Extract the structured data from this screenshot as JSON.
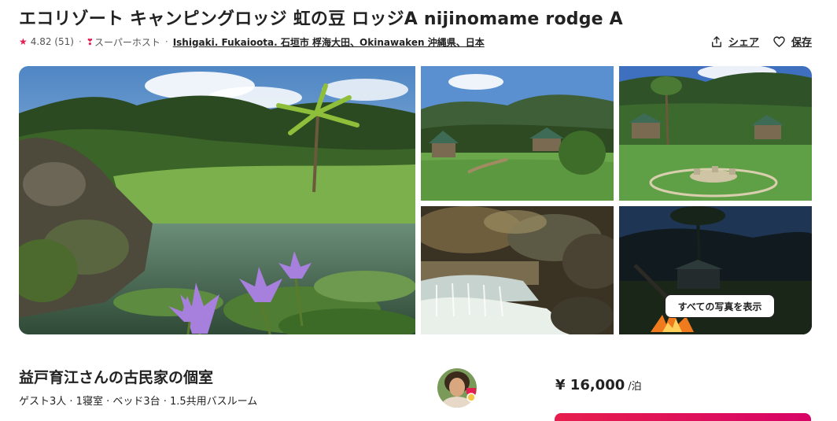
{
  "listing": {
    "title": "エコリゾート キャンピングロッジ 虹の豆 ロッジA nijinomame rodge A",
    "rating": "4.82 (51)",
    "separator": "·",
    "superhost": "スーパーホスト",
    "location": "Ishigaki. Fukaioota. 石垣市 桴海大田、Okinawaken 沖縄県、日本"
  },
  "actions": {
    "share_label": "シェア",
    "save_label": "保存"
  },
  "gallery": {
    "show_all_label": "すべての写真を表示"
  },
  "host": {
    "title": "益戸育江さんの古民家の個室",
    "details": "ゲスト3人 · 1寝室 · ベッド3台 · 1.5共用バスルーム"
  },
  "price": {
    "amount": "¥ 16,000",
    "unit": "/泊"
  },
  "icons": {
    "star": "star-icon",
    "superhost": "medal-icon",
    "share": "share-icon",
    "save": "heart-icon"
  },
  "colors": {
    "brand": "#e51d50",
    "reserve_gradient_start": "#e61e4d",
    "reserve_gradient_end": "#d70466"
  }
}
